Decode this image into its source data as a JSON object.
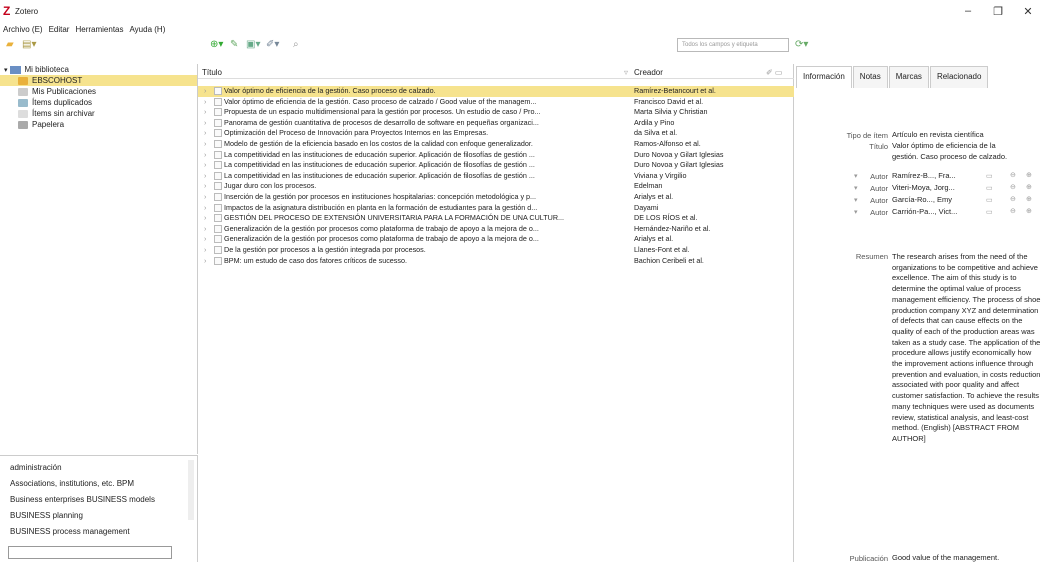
{
  "app": {
    "title": "Zotero",
    "logo": "Z"
  },
  "window": {
    "minimize": "–",
    "maximize": "❐",
    "close": "✕"
  },
  "menu": [
    "Archivo (E)",
    "Editar",
    "Herramientas",
    "Ayuda (H)"
  ],
  "search": {
    "placeholder": "Todos los campos y etiqueta"
  },
  "library": {
    "title": "Mi biblioteca",
    "items": [
      "EBSCOHOST",
      "Mis Publicaciones",
      "Ítems duplicados",
      "Ítems sin archivar",
      "Papelera"
    ]
  },
  "tags": [
    "administración",
    "Associations, institutions, etc.   BPM",
    "Business enterprises   BUSINESS models",
    "BUSINESS planning",
    "BUSINESS process management"
  ],
  "columns": {
    "title": "Título",
    "creator": "Creador"
  },
  "rows": [
    {
      "title": "Valor óptimo de eficiencia de la gestión. Caso proceso de calzado.",
      "creator": "Ramírez-Betancourt et al."
    },
    {
      "title": "Valor óptimo de eficiencia de la gestión. Caso proceso de calzado / Good value of the managem...",
      "creator": "Francisco David et al."
    },
    {
      "title": "Propuesta de un espacio multidimensional para la gestión por procesos. Un estudio de caso / Pro...",
      "creator": "Marta Silvia y Christian"
    },
    {
      "title": "Panorama de gestión cuantitativa de procesos de desarrollo de software en pequeñas organizaci...",
      "creator": "Ardila y Pino"
    },
    {
      "title": "Optimización del Proceso de Innovación para Proyectos Internos en las Empresas.",
      "creator": "da Silva et al."
    },
    {
      "title": "Modelo de gestión de la eficiencia basado en los costos de la calidad con enfoque generalizador.",
      "creator": "Ramos-Alfonso et al."
    },
    {
      "title": "La competitividad en las instituciones de educación superior. Aplicación de filosofías de gestión ...",
      "creator": "Duro Novoa y Gilart Iglesias"
    },
    {
      "title": "La competitividad en las instituciones de educación superior. Aplicación de filosofías de gestión ...",
      "creator": "Duro Novoa y Gilart Iglesias"
    },
    {
      "title": "La competitividad en las instituciones de educación superior. Aplicación de filosofías de gestión ...",
      "creator": "Viviana y Virgilio"
    },
    {
      "title": "Jugar duro con los procesos.",
      "creator": "Edelman"
    },
    {
      "title": "Inserción de la gestión por procesos en instituciones hospitalarias: concepción metodológica y p...",
      "creator": "Arialys et al."
    },
    {
      "title": "Impactos de la asignatura distribución en planta en la formación de estudiantes para la gestión d...",
      "creator": "Dayami"
    },
    {
      "title": "GESTIÓN DEL PROCESO DE EXTENSIÓN UNIVERSITARIA PARA LA FORMACIÓN DE UNA CULTUR...",
      "creator": "DE LOS RÍOS et al."
    },
    {
      "title": "Generalización de la gestión por procesos como plataforma de trabajo de apoyo a la mejora de o...",
      "creator": "Hernández-Nariño et al."
    },
    {
      "title": "Generalización de la gestión por procesos como plataforma de trabajo de apoyo a la mejora de o...",
      "creator": "Arialys et al."
    },
    {
      "title": "De la gestión por procesos a la gestión integrada por procesos.",
      "creator": "Llanes-Font et al."
    },
    {
      "title": "BPM: um estudo de caso dos fatores críticos de sucesso.",
      "creator": "Bachion Ceribeli et al."
    }
  ],
  "tabs": [
    "Información",
    "Notas",
    "Marcas",
    "Relacionado"
  ],
  "info": {
    "type_label": "Tipo de ítem",
    "type_value": "Artículo en revista científica",
    "title_label": "Título",
    "title_value": "Valor óptimo de eficiencia de la gestión. Caso proceso de calzado.",
    "authors": [
      {
        "label": "Autor",
        "value": "Ramírez-B..., Fra..."
      },
      {
        "label": "Autor",
        "value": "Viteri-Moya, Jorg..."
      },
      {
        "label": "Autor",
        "value": "García-Ro..., Emy"
      },
      {
        "label": "Autor",
        "value": "Carrión-Pa..., Vict..."
      }
    ],
    "abstract_label": "Resumen",
    "abstract_value": "The research arises from the need of the organizations to be competitive and achieve excellence. The aim of this study is to determine the optimal value of process management efficiency. The process of shoe production company XYZ and determination of defects that can cause effects on the quality of each of the production areas was taken as a study case. The application of the procedure allows justify economically how the improvement actions influence through prevention and evaluation, in costs reduction associated with poor quality and affect customer satisfaction. To achieve the results many techniques were used as documents review, statistical analysis, and least-cost method. (English) [ABSTRACT FROM AUTHOR]",
    "pub_label": "Publicación",
    "pub_value": "Good value of the management."
  }
}
